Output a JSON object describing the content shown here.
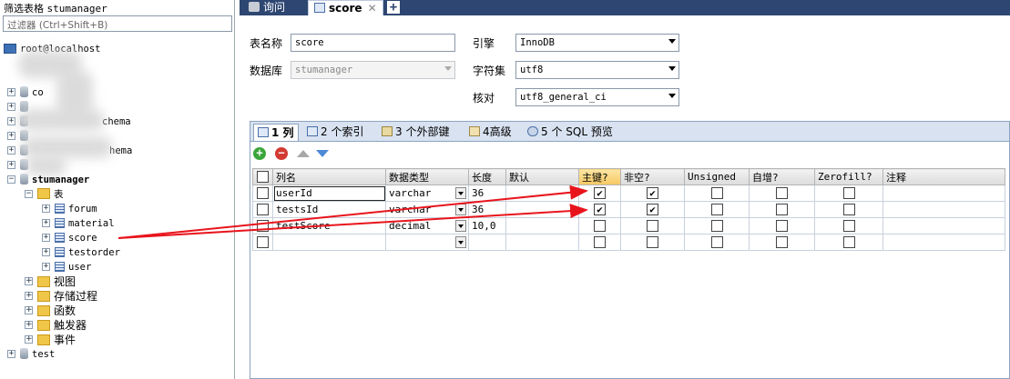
{
  "left_panel": {
    "title_prefix": "筛选表格",
    "title_db": "stumanager",
    "filter_placeholder": "过滤器 (Ctrl+Shift+B)",
    "server": "root@localhost",
    "partial_db_1": "co",
    "partial_db_2": "chema",
    "partial_db_3": "hema",
    "active_db": "stumanager",
    "tables_folder": "表",
    "tables": [
      "forum",
      "material",
      "score",
      "testorder",
      "user"
    ],
    "folders": [
      "视图",
      "存储过程",
      "函数",
      "触发器",
      "事件"
    ],
    "last_db": "test"
  },
  "tabs": [
    {
      "label": "询问",
      "icon": "query-icon"
    },
    {
      "label": "score",
      "icon": "table-design-icon"
    }
  ],
  "form": {
    "table_name_label": "表名称",
    "table_name_value": "score",
    "database_label": "数据库",
    "database_value": "stumanager",
    "engine_label": "引擎",
    "engine_value": "InnoDB",
    "charset_label": "字符集",
    "charset_value": "utf8",
    "collation_label": "核对",
    "collation_value": "utf8_general_ci"
  },
  "subtabs": [
    "1 列",
    "2 个索引",
    "3 个外部键",
    "4高级",
    "5 个 SQL 预览"
  ],
  "grid": {
    "headers": [
      "列名",
      "数据类型",
      "长度",
      "默认",
      "主键?",
      "非空?",
      "Unsigned",
      "自增?",
      "Zerofill?",
      "注释"
    ],
    "rows": [
      {
        "name": "userId",
        "type": "varchar",
        "length": "36",
        "default": "",
        "pk": true,
        "notnull": true,
        "unsigned": false,
        "autoinc": false,
        "zerofill": false,
        "comment": ""
      },
      {
        "name": "testsId",
        "type": "varchar",
        "length": "36",
        "default": "",
        "pk": true,
        "notnull": true,
        "unsigned": false,
        "autoinc": false,
        "zerofill": false,
        "comment": ""
      },
      {
        "name": "testScore",
        "type": "decimal",
        "length": "10,0",
        "default": "",
        "pk": false,
        "notnull": false,
        "unsigned": false,
        "autoinc": false,
        "zerofill": false,
        "comment": ""
      },
      {
        "name": "",
        "type": "",
        "length": "",
        "default": "",
        "pk": false,
        "notnull": false,
        "unsigned": false,
        "autoinc": false,
        "zerofill": false,
        "comment": ""
      }
    ]
  },
  "colors": {
    "tabbar": "#2e4772",
    "annotation": "#e8141c",
    "header_highlight": "#f6c862"
  }
}
